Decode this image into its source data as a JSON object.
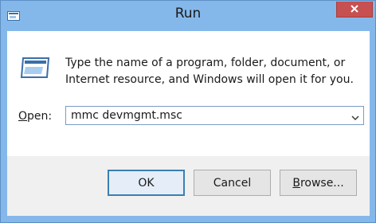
{
  "window": {
    "title": "Run",
    "close_icon": "close-icon"
  },
  "dialog": {
    "message_line1": "Type the name of a program, folder, document, or",
    "message_line2": "Internet resource, and Windows will open it for you.",
    "open_label_prefix": "",
    "open_label_underlined": "O",
    "open_label_rest": "pen:",
    "open_value": "mmc devmgmt.msc"
  },
  "buttons": {
    "ok": "OK",
    "cancel": "Cancel",
    "browse_underlined": "B",
    "browse_rest": "rowse..."
  },
  "colors": {
    "frame": "#85b8ea",
    "close_button": "#c75050",
    "default_button_border": "#3c7fb1"
  }
}
